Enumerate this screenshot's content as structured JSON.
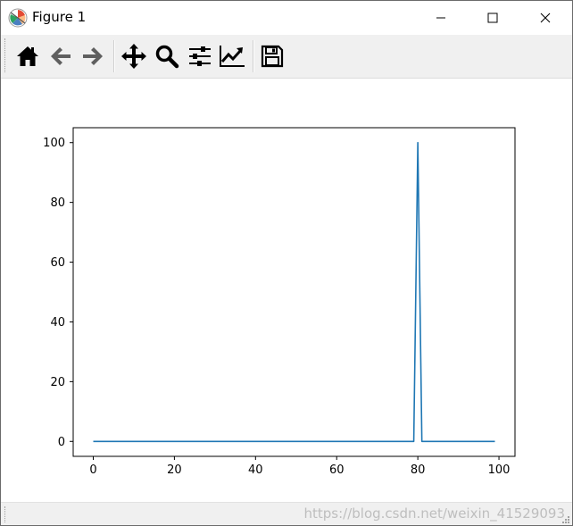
{
  "window": {
    "title": "Figure 1"
  },
  "titlebar_buttons": {
    "minimize_icon": "minimize-icon",
    "maximize_icon": "maximize-icon",
    "close_icon": "close-icon"
  },
  "toolbar": {
    "buttons": [
      {
        "name": "home",
        "icon": "home-icon"
      },
      {
        "name": "back",
        "icon": "arrow-left-icon"
      },
      {
        "name": "forward",
        "icon": "arrow-right-icon"
      },
      {
        "name": "pan",
        "icon": "move-icon"
      },
      {
        "name": "zoom",
        "icon": "magnifier-icon"
      },
      {
        "name": "subplots",
        "icon": "sliders-icon"
      },
      {
        "name": "customize",
        "icon": "line-chart-icon"
      },
      {
        "name": "save",
        "icon": "floppy-disk-icon"
      }
    ]
  },
  "chart_data": {
    "type": "line",
    "title": "",
    "xlabel": "",
    "ylabel": "",
    "xlim": [
      -4.95,
      103.95
    ],
    "ylim": [
      -5,
      105
    ],
    "xticks": [
      0,
      20,
      40,
      60,
      80,
      100
    ],
    "xtick_labels": [
      "0",
      "20",
      "40",
      "60",
      "80",
      "100"
    ],
    "yticks": [
      0,
      20,
      40,
      60,
      80,
      100
    ],
    "ytick_labels": [
      "0",
      "20",
      "40",
      "60",
      "80",
      "100"
    ],
    "grid": false,
    "series": [
      {
        "color": "#1f77b4",
        "x": [
          0,
          79,
          80,
          81,
          99
        ],
        "y": [
          0,
          0,
          100,
          0,
          0
        ]
      }
    ]
  },
  "statusbar": {
    "watermark": "https://blog.csdn.net/weixin_41529093"
  }
}
